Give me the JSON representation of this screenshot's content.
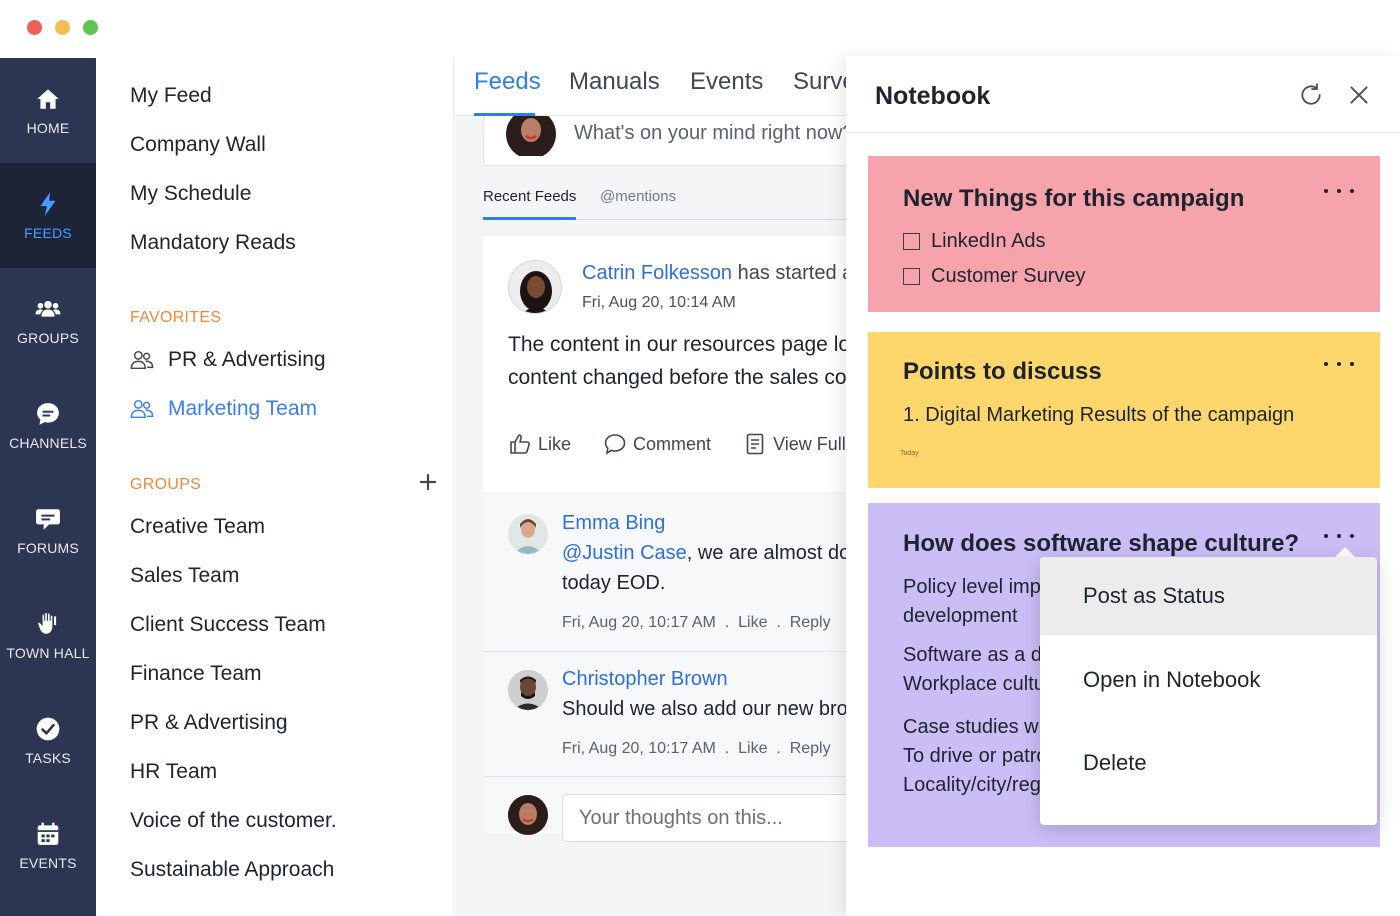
{
  "rail": {
    "items": [
      {
        "label": "HOME",
        "icon": "home-icon"
      },
      {
        "label": "FEEDS",
        "icon": "bolt-icon"
      },
      {
        "label": "GROUPS",
        "icon": "groups-icon"
      },
      {
        "label": "CHANNELS",
        "icon": "chat-bubble-icon"
      },
      {
        "label": "FORUMS",
        "icon": "forum-icon"
      },
      {
        "label": "TOWN HALL",
        "icon": "raised-hand-icon"
      },
      {
        "label": "TASKS",
        "icon": "check-circle-icon"
      },
      {
        "label": "EVENTS",
        "icon": "calendar-icon"
      }
    ],
    "active": "FEEDS",
    "active_color": "#4a9cff",
    "bg_color": "#2c3551"
  },
  "nav": {
    "links": [
      "My Feed",
      "Company Wall",
      "My Schedule",
      "Mandatory Reads"
    ],
    "favorites_heading": "FAVORITES",
    "favorites": [
      {
        "label": "PR & Advertising",
        "selected": false
      },
      {
        "label": "Marketing Team",
        "selected": true
      }
    ],
    "groups_heading": "GROUPS",
    "groups": [
      "Creative Team",
      "Sales Team",
      "Client Success Team",
      "Finance Team",
      "PR & Advertising",
      "HR Team",
      "Voice of the customer.",
      "Sustainable Approach"
    ],
    "accent_color": "#f0883a"
  },
  "feed": {
    "tabs": [
      "Feeds",
      "Manuals",
      "Events",
      "Surve"
    ],
    "active_tab": "Feeds",
    "composer_placeholder": "What's on your mind right now?",
    "subtabs": [
      "Recent Feeds",
      "@mentions"
    ],
    "post": {
      "author": "Catrin Folkesson",
      "action": " has started a",
      "time": "Fri, Aug 20, 10:14 AM",
      "body_line1": "The content in our resources page lo",
      "body_line2": "content changed before the sales co",
      "actions": [
        "Like",
        "Comment",
        "View Full P"
      ]
    },
    "comments": [
      {
        "author": "Emma Bing",
        "mention": "@Justin Case",
        "text1": ", we are almost don",
        "text2": "today EOD.",
        "time": "Fri, Aug 20, 10:17 AM",
        "like": "Like",
        "reply": "Reply"
      },
      {
        "author": "Christopher Brown",
        "text1": "Should we also add our new bro",
        "time": "Fri, Aug 20, 10:17 AM",
        "like": "Like",
        "reply": "Reply"
      }
    ],
    "reply_placeholder": "Your thoughts on this..."
  },
  "notebook": {
    "title": "Notebook",
    "notes": [
      {
        "title": "New Things for this campaign",
        "color": "#f7a3ab",
        "checklist": [
          "LinkedIn Ads",
          "Customer Survey"
        ]
      },
      {
        "title": "Points to discuss",
        "color": "#fdd66c",
        "lines": [
          "1. Digital Marketing Results of the campaign"
        ],
        "tiny": "Today"
      },
      {
        "title": "How does software shape culture?",
        "color": "#cbbdf6",
        "lines": [
          "Policy level impl",
          "development",
          "Software as a dr",
          "Workplace cultu",
          "Case studies wh",
          "To drive or patro",
          "Locality/city/reg"
        ]
      }
    ],
    "context_menu": [
      "Post as Status",
      "Open in Notebook",
      "Delete"
    ],
    "menu_hovered": "Post as Status"
  }
}
